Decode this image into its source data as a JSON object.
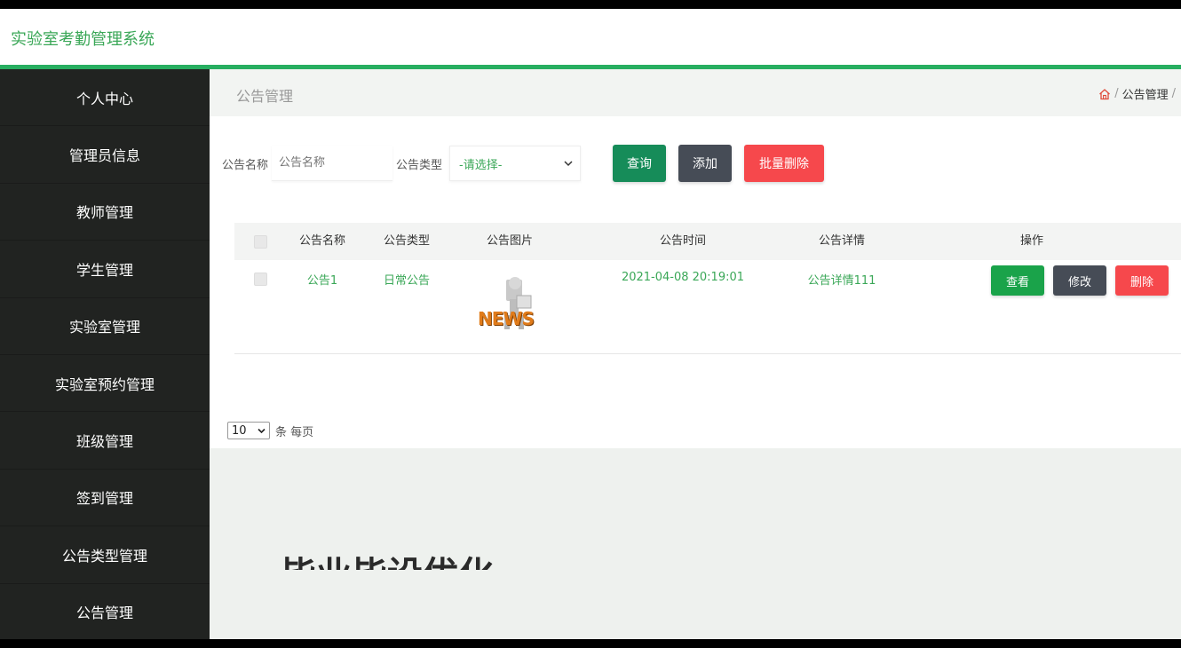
{
  "app": {
    "title": "实验室考勤管理系统"
  },
  "sidebar": {
    "items": [
      {
        "label": "个人中心"
      },
      {
        "label": "管理员信息"
      },
      {
        "label": "教师管理"
      },
      {
        "label": "学生管理"
      },
      {
        "label": "实验室管理"
      },
      {
        "label": "实验室预约管理"
      },
      {
        "label": "班级管理"
      },
      {
        "label": "签到管理"
      },
      {
        "label": "公告类型管理"
      },
      {
        "label": "公告管理"
      }
    ]
  },
  "page": {
    "title": "公告管理",
    "breadcrumb": {
      "current": "公告管理",
      "separator": "/"
    }
  },
  "search": {
    "name_label": "公告名称",
    "name_placeholder": "公告名称",
    "type_label": "公告类型",
    "type_selected": "-请选择-",
    "search_btn": "查询",
    "add_btn": "添加",
    "bulk_delete_btn": "批量删除"
  },
  "table": {
    "headers": [
      "公告名称",
      "公告类型",
      "公告图片",
      "公告时间",
      "公告详情",
      "操作"
    ],
    "rows": [
      {
        "name": "公告1",
        "type": "日常公告",
        "image_text": "NEWS",
        "time": "2021-04-08 20:19:01",
        "detail": "公告详情111",
        "view": "查看",
        "edit": "修改",
        "delete": "删除"
      }
    ]
  },
  "pager": {
    "page_size": "10",
    "suffix": "条 每页"
  },
  "colors": {
    "accent": "#27ae60",
    "sidebar": "#212321",
    "danger": "#f6484c",
    "dark": "#464c56"
  },
  "watermark": "毕业毕设优化"
}
